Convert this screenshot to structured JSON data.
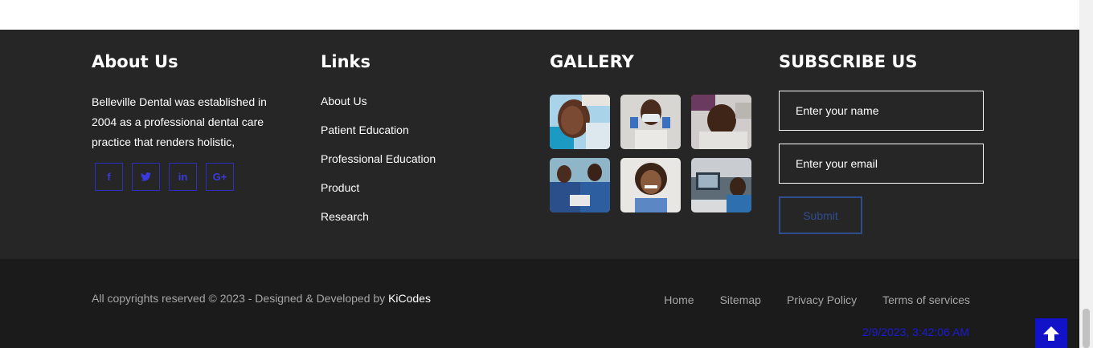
{
  "about": {
    "title": "About Us",
    "text": "Belleville Dental was established in 2004 as a professional dental care practice that renders holistic,",
    "socials": [
      {
        "icon": "facebook-icon",
        "glyph": "f"
      },
      {
        "icon": "twitter-icon",
        "glyph": "t"
      },
      {
        "icon": "linkedin-icon",
        "glyph": "in"
      },
      {
        "icon": "google-plus-icon",
        "glyph": "G+"
      }
    ]
  },
  "links": {
    "title": "Links",
    "items": [
      "About Us",
      "Patient Education",
      "Professional Education",
      "Product",
      "Research"
    ]
  },
  "gallery": {
    "title": "GALLERY",
    "images": [
      "patient-mouth-photo",
      "dentist-mask-photo",
      "patient-smile-photo",
      "dental-team-photo",
      "woman-smiling-photo",
      "dentist-computer-photo"
    ]
  },
  "subscribe": {
    "title": "SUBSCRIBE US",
    "name_placeholder": "Enter your name",
    "email_placeholder": "Enter your email",
    "submit_label": "Submit"
  },
  "bottom": {
    "copyright_prefix": "All copyrights reserved © 2023 - Designed & Developed by ",
    "brand": "KiCodes",
    "nav": [
      "Home",
      "Sitemap",
      "Privacy Policy",
      "Terms of services"
    ],
    "datetime": "2/9/2023, 3:42:06 AM"
  },
  "colors": {
    "footer_bg": "#262626",
    "bottom_bg": "#1b1b1b",
    "accent_blue": "#1212c8",
    "social_blue": "#3a3ae0"
  }
}
